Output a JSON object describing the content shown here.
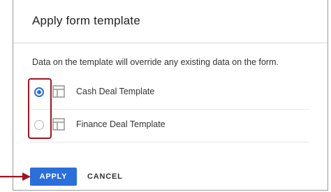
{
  "dialog": {
    "title": "Apply form template",
    "description": "Data on the template will override any existing data on the form."
  },
  "options": [
    {
      "label": "Cash Deal Template",
      "selected": true,
      "icon": "template-icon"
    },
    {
      "label": "Finance Deal Template",
      "selected": false,
      "icon": "template-icon"
    }
  ],
  "footer": {
    "apply_label": "APPLY",
    "cancel_label": "CANCEL"
  },
  "colors": {
    "accent": "#2a6fdb",
    "highlight": "#a0141e"
  }
}
